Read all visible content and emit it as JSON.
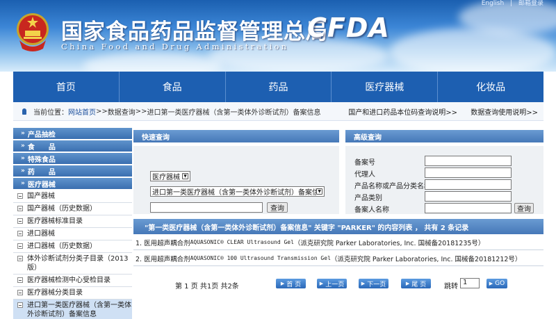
{
  "header": {
    "top_links": [
      "English",
      "|",
      "邮箱登录"
    ],
    "title": "国家食品药品监督管理总局",
    "subtitle": "China Food and Drug Administration",
    "logo": "CFDA"
  },
  "nav": {
    "items": [
      "首页",
      "食品",
      "药品",
      "医疗器械",
      "化妆品"
    ]
  },
  "breadcrumb": {
    "prefix": "当前位置：",
    "home": "网站首页",
    "sep1": ">> ",
    "query": "数据查询",
    "sep2": ">> ",
    "current": "进口第一类医疗器械（含第一类体外诊断试剂）备案信息",
    "right_link1": "国产和进口药品本位码查询说明",
    "right_sep": ">>",
    "right_link2": "数据查询使用说明",
    "right_sep2": ">>"
  },
  "sidebar": {
    "categories": [
      {
        "label": "产品抽检"
      },
      {
        "label": "食　　品"
      },
      {
        "label": "特殊食品"
      },
      {
        "label": "药　　品"
      },
      {
        "label": "医疗器械"
      }
    ],
    "items": [
      "国产器械",
      "国产器械（历史数据）",
      "医疗器械标准目录",
      "进口器械",
      "进口器械（历史数据）",
      "体外诊断试剂分类子目录（2013版）",
      "医疗器械检测中心受检目录",
      "医疗器械分类目录",
      "进口第一类医疗器械（含第一类体外诊断试剂）备案信息"
    ]
  },
  "quick_search": {
    "title": "快速查询",
    "category_select": "医疗器械",
    "dataset_select": "进口第一类医疗器械（含第一类体外诊断试剂）备案信息",
    "keyword_value": "",
    "button": "查询"
  },
  "advanced_search": {
    "title": "高级查询",
    "fields": [
      "备案号",
      "代理人",
      "产品名称或产品分类名称",
      "产品类别",
      "备案人名称"
    ],
    "button": "查询"
  },
  "results": {
    "header": "\"第一类医疗器械（含第一类体外诊断试剂）备案信息\" 关键字 \"PARKER\" 的内容列表 ， 共有 2 条记录",
    "rows": [
      {
        "prefix": "1. 医用超声耦合剂 ",
        "mono": "AQUASONIC® CLEAR Ultrasound Gel",
        "suffix": "（派克研究院 Parker Laboratories, Inc. 国械备20181235号）"
      },
      {
        "prefix": "2. 医用超声耦合剂 ",
        "mono": "AQUASONIC® 100 Ultrasound Transmission Gel",
        "suffix": "（派克研究院 Parker Laboratories, Inc. 国械备20181212号）"
      }
    ]
  },
  "pager": {
    "info": "第 1 页 共1页 共2条",
    "first": "首 页",
    "prev": "上一页",
    "next": "下一页",
    "last": "尾 页",
    "jump_label": "跳转",
    "jump_value": "1",
    "go": "GO"
  },
  "colors": {
    "nav_blue": "#1d5fb1",
    "panel_blue": "#4678b8",
    "link_blue": "#1c4f9c"
  }
}
